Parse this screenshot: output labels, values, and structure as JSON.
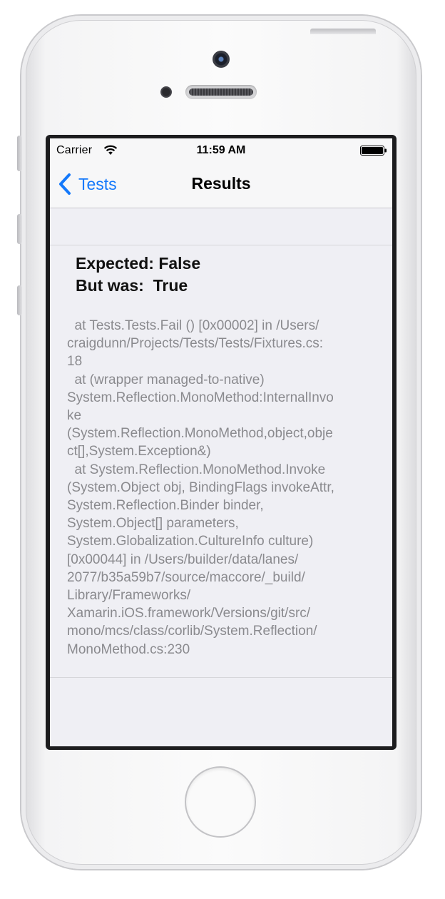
{
  "status_bar": {
    "carrier": "Carrier",
    "time": "11:59 AM",
    "wifi_icon": "wifi-icon",
    "battery_icon": "battery-icon"
  },
  "nav_bar": {
    "back_label": "Tests",
    "back_icon": "chevron-left-icon",
    "title": "Results",
    "accent_color": "#1479fb"
  },
  "result": {
    "expected_line": "Expected: False",
    "actual_line": "But was:  True",
    "stack_trace_lines": [
      "  at Tests.Tests.Fail () [0x00002] in /Users/",
      "craigdunn/Projects/Tests/Tests/Fixtures.cs:",
      "18",
      "  at (wrapper managed-to-native)",
      "System.Reflection.MonoMethod:InternalInvo",
      "ke",
      "(System.Reflection.MonoMethod,object,obje",
      "ct[],System.Exception&)",
      "  at System.Reflection.MonoMethod.Invoke",
      "(System.Object obj, BindingFlags invokeAttr,",
      "System.Reflection.Binder binder,",
      "System.Object[] parameters,",
      "System.Globalization.CultureInfo culture)",
      "[0x00044] in /Users/builder/data/lanes/",
      "2077/b35a59b7/source/maccore/_build/",
      "Library/Frameworks/",
      "Xamarin.iOS.framework/Versions/git/src/",
      "mono/mcs/class/corlib/System.Reflection/",
      "MonoMethod.cs:230"
    ]
  }
}
